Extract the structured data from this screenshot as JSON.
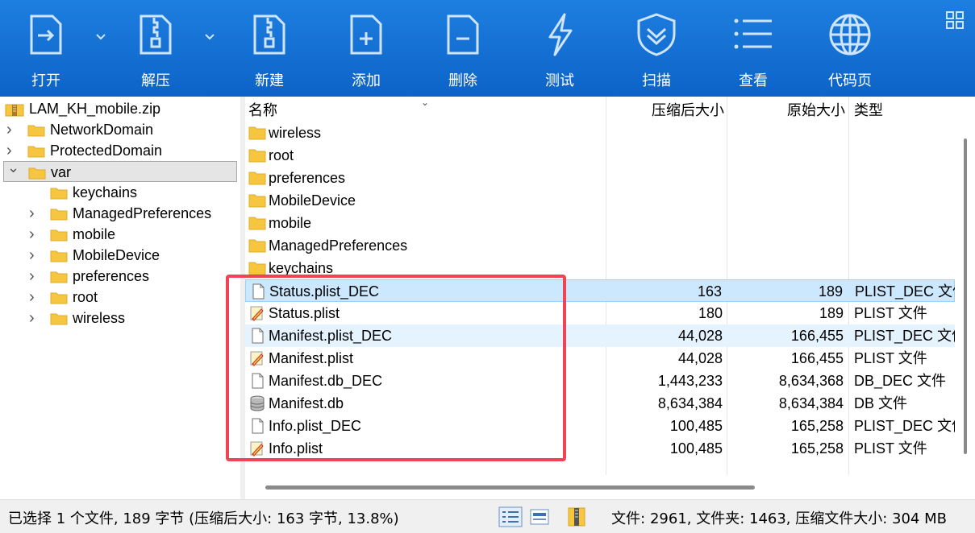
{
  "toolbar": {
    "buttons": [
      {
        "label": "打开",
        "icon": "open-file-icon",
        "has_dropdown": true
      },
      {
        "label": "解压",
        "icon": "extract-zip-icon",
        "has_dropdown": true
      },
      {
        "label": "新建",
        "icon": "new-archive-icon"
      },
      {
        "label": "添加",
        "icon": "add-file-icon"
      },
      {
        "label": "删除",
        "icon": "delete-file-icon"
      },
      {
        "label": "测试",
        "icon": "test-lightning-icon"
      },
      {
        "label": "扫描",
        "icon": "scan-shield-icon"
      },
      {
        "label": "查看",
        "icon": "view-list-icon"
      },
      {
        "label": "代码页",
        "icon": "globe-icon"
      }
    ],
    "background": "#1473d6"
  },
  "tree": {
    "root": "LAM_KH_mobile.zip",
    "items": [
      {
        "label": "NetworkDomain",
        "level": 1,
        "expandable": true
      },
      {
        "label": "ProtectedDomain",
        "level": 1,
        "expandable": true
      },
      {
        "label": "var",
        "level": 1,
        "expanded": true,
        "selected": true
      },
      {
        "label": "keychains",
        "level": 2,
        "expandable": false
      },
      {
        "label": "ManagedPreferences",
        "level": 2,
        "expandable": true
      },
      {
        "label": "mobile",
        "level": 2,
        "expandable": true
      },
      {
        "label": "MobileDevice",
        "level": 2,
        "expandable": true
      },
      {
        "label": "preferences",
        "level": 2,
        "expandable": true
      },
      {
        "label": "root",
        "level": 2,
        "expandable": true
      },
      {
        "label": "wireless",
        "level": 2,
        "expandable": true
      }
    ]
  },
  "columns": {
    "name": "名称",
    "compressed": "压缩后大小",
    "original": "原始大小",
    "type": "类型"
  },
  "files": [
    {
      "name": "wireless",
      "icon": "folder-icon",
      "compressed": "",
      "original": "",
      "type": ""
    },
    {
      "name": "root",
      "icon": "folder-icon",
      "compressed": "",
      "original": "",
      "type": ""
    },
    {
      "name": "preferences",
      "icon": "folder-icon",
      "compressed": "",
      "original": "",
      "type": ""
    },
    {
      "name": "MobileDevice",
      "icon": "folder-icon",
      "compressed": "",
      "original": "",
      "type": ""
    },
    {
      "name": "mobile",
      "icon": "folder-icon",
      "compressed": "",
      "original": "",
      "type": ""
    },
    {
      "name": "ManagedPreferences",
      "icon": "folder-icon",
      "compressed": "",
      "original": "",
      "type": ""
    },
    {
      "name": "keychains",
      "icon": "folder-icon",
      "compressed": "",
      "original": "",
      "type": ""
    },
    {
      "name": "Status.plist_DEC",
      "icon": "document-icon",
      "compressed": "163",
      "original": "189",
      "type": "PLIST_DEC 文件",
      "selected": true
    },
    {
      "name": "Status.plist",
      "icon": "plist-edit-icon",
      "compressed": "180",
      "original": "189",
      "type": "PLIST 文件"
    },
    {
      "name": "Manifest.plist_DEC",
      "icon": "document-icon",
      "compressed": "44,028",
      "original": "166,455",
      "type": "PLIST_DEC 文件",
      "hover": true
    },
    {
      "name": "Manifest.plist",
      "icon": "plist-edit-icon",
      "compressed": "44,028",
      "original": "166,455",
      "type": "PLIST 文件"
    },
    {
      "name": "Manifest.db_DEC",
      "icon": "document-icon",
      "compressed": "1,443,233",
      "original": "8,634,368",
      "type": "DB_DEC 文件"
    },
    {
      "name": "Manifest.db",
      "icon": "database-icon",
      "compressed": "8,634,384",
      "original": "8,634,384",
      "type": "DB 文件"
    },
    {
      "name": "Info.plist_DEC",
      "icon": "document-icon",
      "compressed": "100,485",
      "original": "165,258",
      "type": "PLIST_DEC 文件"
    },
    {
      "name": "Info.plist",
      "icon": "plist-edit-icon",
      "compressed": "100,485",
      "original": "165,258",
      "type": "PLIST 文件"
    }
  ],
  "status": {
    "left": "已选择 1 个文件, 189 字节 (压缩后大小: 163 字节, 13.8%)",
    "right": "文件: 2961, 文件夹: 1463, 压缩文件大小: 304 MB"
  },
  "colors": {
    "highlight_box": "#ee4455",
    "selected_row": "#cce8ff",
    "folder": "#f7c640"
  }
}
